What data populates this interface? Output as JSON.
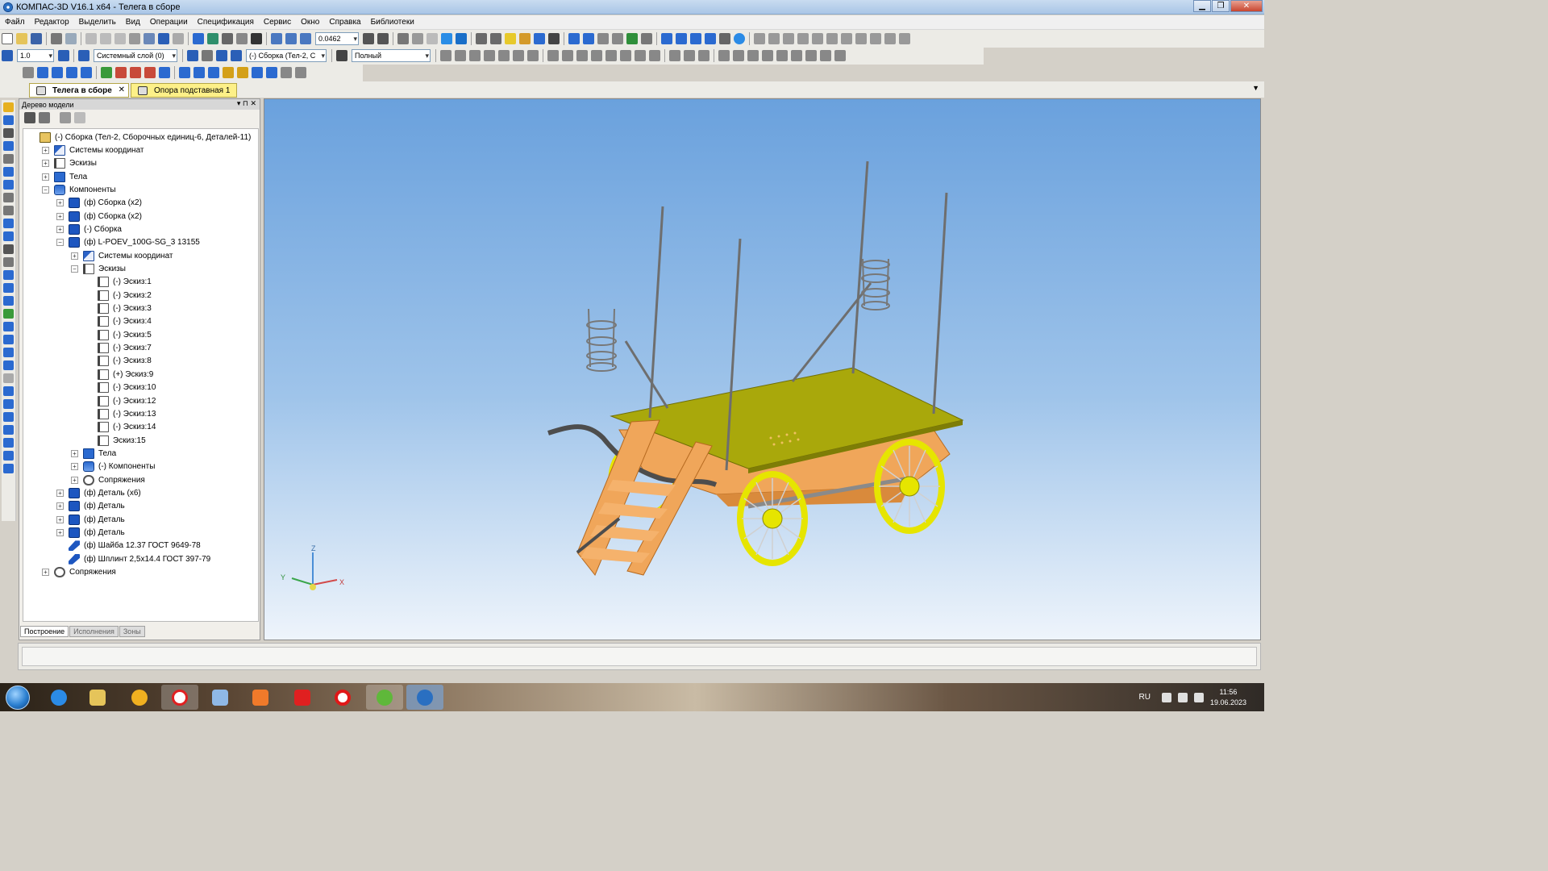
{
  "window": {
    "title": "КОМПАС-3D V16.1 x64 - Телега в сборе",
    "minimize": "▁",
    "maximize": "❐",
    "close": "✕"
  },
  "menu": [
    "Файл",
    "Редактор",
    "Выделить",
    "Вид",
    "Операции",
    "Спецификация",
    "Сервис",
    "Окно",
    "Справка",
    "Библиотеки"
  ],
  "toolbar": {
    "zoom_value": "0.0462",
    "step_value": "1.0",
    "layer_value": "Системный слой (0)",
    "component_value": "(-) Сборка (Тел-2, С",
    "view_mode": "Полный"
  },
  "doc_tabs": [
    {
      "label": "Телега в сборе",
      "close": "✕"
    },
    {
      "label": "Опора подставная 1"
    }
  ],
  "panel": {
    "title": "Дерево модели",
    "pin": "▾ ⊓ ✕"
  },
  "tree": [
    {
      "text": "(-) Сборка (Тел-2, Сборочных единиц-6, Деталей-11)",
      "level": 0,
      "icon": "root",
      "pm": ""
    },
    {
      "text": "Системы координат",
      "level": 1,
      "icon": "cs",
      "pm": "+"
    },
    {
      "text": "Эскизы",
      "level": 1,
      "icon": "sk",
      "pm": "+"
    },
    {
      "text": "Тела",
      "level": 1,
      "icon": "bd",
      "pm": "+"
    },
    {
      "text": "Компоненты",
      "level": 1,
      "icon": "cm",
      "pm": "−"
    },
    {
      "text": "(ф) Сборка (x2)",
      "level": 2,
      "icon": "asm",
      "pm": "+"
    },
    {
      "text": "(ф) Сборка (x2)",
      "level": 2,
      "icon": "asm",
      "pm": "+"
    },
    {
      "text": "(-) Сборка",
      "level": 2,
      "icon": "asm",
      "pm": "+"
    },
    {
      "text": "(ф) L-POEV_100G-SG_3 13155",
      "level": 2,
      "icon": "asm",
      "pm": "−"
    },
    {
      "text": "Системы координат",
      "level": 3,
      "icon": "cs",
      "pm": "+"
    },
    {
      "text": "Эскизы",
      "level": 3,
      "icon": "sk",
      "pm": "−"
    },
    {
      "text": "(-) Эскиз:1",
      "level": 4,
      "icon": "sk",
      "pm": ""
    },
    {
      "text": "(-) Эскиз:2",
      "level": 4,
      "icon": "sk",
      "pm": ""
    },
    {
      "text": "(-) Эскиз:3",
      "level": 4,
      "icon": "sk",
      "pm": ""
    },
    {
      "text": "(-) Эскиз:4",
      "level": 4,
      "icon": "sk",
      "pm": ""
    },
    {
      "text": "(-) Эскиз:5",
      "level": 4,
      "icon": "sk",
      "pm": ""
    },
    {
      "text": "(-) Эскиз:7",
      "level": 4,
      "icon": "sk",
      "pm": ""
    },
    {
      "text": "(-) Эскиз:8",
      "level": 4,
      "icon": "sk",
      "pm": ""
    },
    {
      "text": "(+) Эскиз:9",
      "level": 4,
      "icon": "sk",
      "pm": ""
    },
    {
      "text": "(-) Эскиз:10",
      "level": 4,
      "icon": "sk",
      "pm": ""
    },
    {
      "text": "(-) Эскиз:12",
      "level": 4,
      "icon": "sk",
      "pm": ""
    },
    {
      "text": "(-) Эскиз:13",
      "level": 4,
      "icon": "sk",
      "pm": ""
    },
    {
      "text": "(-) Эскиз:14",
      "level": 4,
      "icon": "sk",
      "pm": ""
    },
    {
      "text": "Эскиз:15",
      "level": 4,
      "icon": "sk",
      "pm": ""
    },
    {
      "text": "Тела",
      "level": 3,
      "icon": "bd",
      "pm": "+"
    },
    {
      "text": "(-) Компоненты",
      "level": 3,
      "icon": "cm",
      "pm": "+"
    },
    {
      "text": "Сопряжения",
      "level": 3,
      "icon": "mt",
      "pm": "+"
    },
    {
      "text": "(ф) Деталь (x6)",
      "level": 2,
      "icon": "asm",
      "pm": "+"
    },
    {
      "text": "(ф) Деталь",
      "level": 2,
      "icon": "asm",
      "pm": "+"
    },
    {
      "text": "(ф) Деталь",
      "level": 2,
      "icon": "asm",
      "pm": "+"
    },
    {
      "text": "(ф) Деталь",
      "level": 2,
      "icon": "asm",
      "pm": "+"
    },
    {
      "text": "(ф) Шайба 12.37 ГОСТ 9649-78",
      "level": 2,
      "icon": "st",
      "pm": ""
    },
    {
      "text": "(ф) Шплинт 2,5x14.4 ГОСТ 397-79",
      "level": 2,
      "icon": "st",
      "pm": ""
    },
    {
      "text": "Сопряжения",
      "level": 1,
      "icon": "mt",
      "pm": "+"
    }
  ],
  "panel_tabs": [
    "Построение",
    "Исполнения",
    "Зоны"
  ],
  "axes": {
    "x": "X",
    "y": "Y",
    "z": "Z"
  },
  "tray": {
    "lang": "RU",
    "time": "11:56",
    "date": "19.06.2023"
  },
  "colors": {
    "accent": "#2b6ad0",
    "deck": "#a9a80b",
    "wheel": "#e6e500",
    "frame": "#f0a65a"
  }
}
